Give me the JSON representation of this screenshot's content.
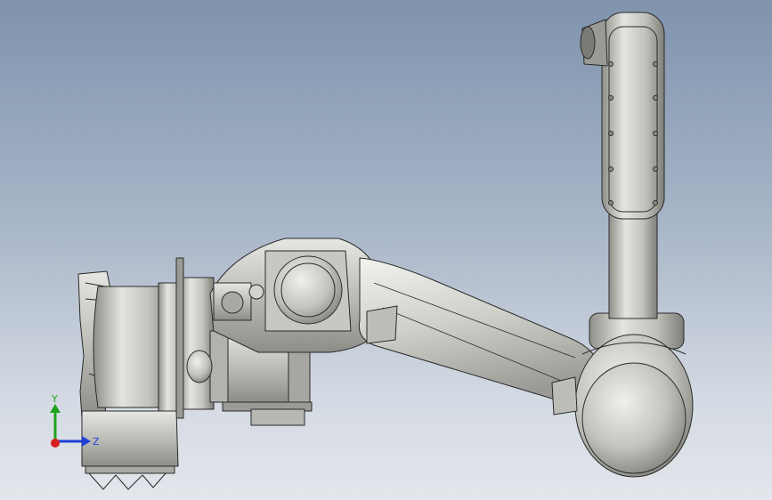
{
  "viewport": {
    "background_top": "#7f93ad",
    "background_bottom": "#e3e6eb"
  },
  "model": {
    "part_color": "#c9c9c4",
    "edge_color": "#2a2a2a"
  },
  "triad": {
    "y_label": "Y",
    "z_label": "Z",
    "y_color": "#1fa31f",
    "z_color": "#1f3fd6",
    "x_color": "#d61f1f"
  }
}
